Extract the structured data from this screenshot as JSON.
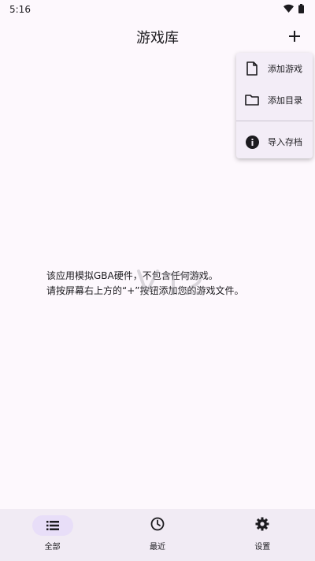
{
  "status_bar": {
    "time": "5:16",
    "icons": [
      "wifi-icon",
      "battery-icon"
    ]
  },
  "app_bar": {
    "title": "游戏库",
    "add_icon": "plus-icon"
  },
  "menu": {
    "items": [
      {
        "label": "添加游戏",
        "icon": "file-icon"
      },
      {
        "label": "添加目录",
        "icon": "folder-icon"
      },
      {
        "label": "导入存档",
        "icon": "info-icon"
      }
    ]
  },
  "empty_state": {
    "line1": "该应用模拟GBA硬件，不包含任何游戏。",
    "line2": "请按屏幕右上方的“+”按钮添加您的游戏文件。"
  },
  "nav": {
    "items": [
      {
        "label": "全部",
        "icon": "list-icon",
        "active": true
      },
      {
        "label": "最近",
        "icon": "clock-icon",
        "active": false
      },
      {
        "label": "设置",
        "icon": "gear-icon",
        "active": false
      }
    ]
  },
  "colors": {
    "background": "#fdf8fd",
    "menu_background": "#f3edf7",
    "nav_background": "#f1ebf4",
    "nav_active_indicator": "#e8def8",
    "text": "#1c1b1f"
  }
}
